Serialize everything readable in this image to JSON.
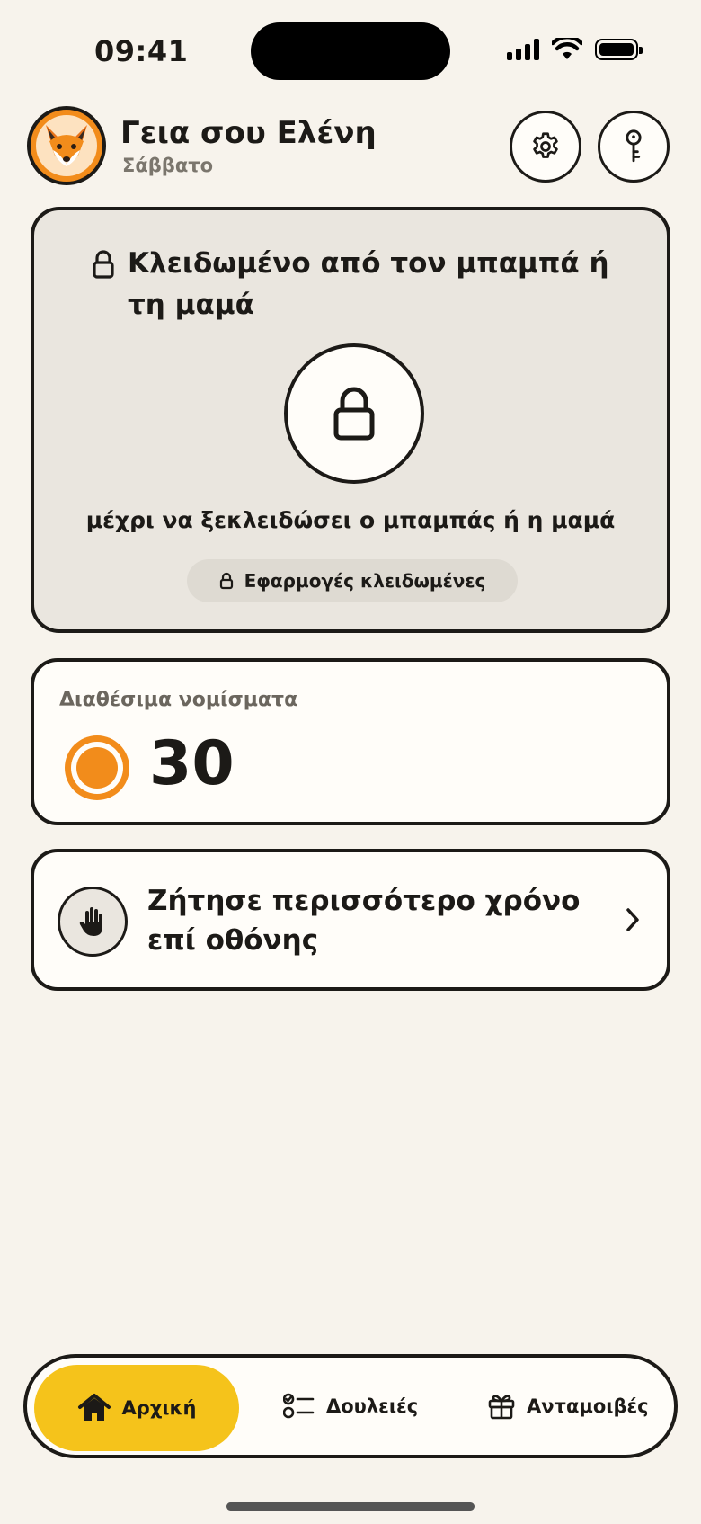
{
  "status_bar": {
    "time": "09:41"
  },
  "header": {
    "greeting": "Γεια σου Ελένη",
    "day": "Σάββατο",
    "avatar_icon": "fox-avatar"
  },
  "locked_card": {
    "title": "Κλειδωμένο από τον μπαμπά ή τη μαμά",
    "message": "μέχρι να ξεκλειδώσει ο μπαμπάς ή η μαμά",
    "apps_status": "Εφαρμογές κλειδωμένες"
  },
  "coins": {
    "label": "Διαθέσιμα νομίσματα",
    "value": "30"
  },
  "request": {
    "label": "Ζήτησε περισσότερο χρόνο επί οθόνης"
  },
  "nav": {
    "home": "Αρχική",
    "chores": "Δουλειές",
    "rewards": "Ανταμοιβές"
  },
  "colors": {
    "background": "#f7f3ec",
    "accent_yellow": "#f5c31b",
    "coin_orange": "#f28c1b",
    "ink": "#1c1a17"
  }
}
